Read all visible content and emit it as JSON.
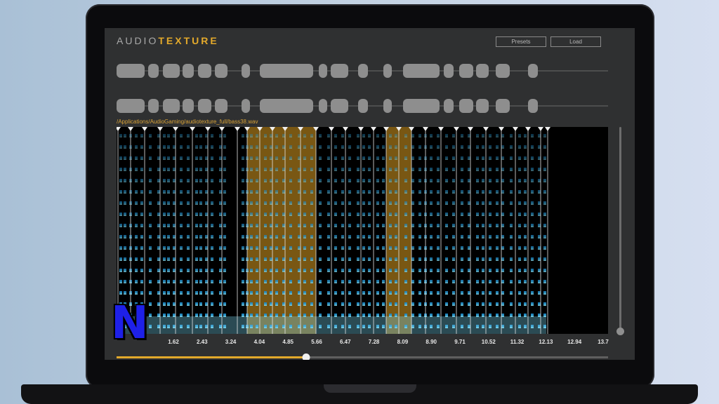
{
  "app": {
    "brand_light": "AUDIO",
    "brand_bold": "TEXTURE",
    "brand_light_color": "#a9a9a9",
    "brand_bold_color": "#e3a92b"
  },
  "toolbar": {
    "presets_label": "Presets",
    "load_label": "Load"
  },
  "file": {
    "path": "/Applications/AudioGaming/audiotexture_full/bass38.wav"
  },
  "timeline": {
    "ticks": [
      "1.62",
      "2.43",
      "3.24",
      "4.04",
      "4.85",
      "5.66",
      "6.47",
      "7.28",
      "8.09",
      "8.90",
      "9.71",
      "10.52",
      "11.32",
      "12.13",
      "12.94",
      "13.7"
    ],
    "playback_fraction": 0.385
  },
  "overlay": {
    "logo_letter": "N",
    "logo_color": "#1e20e8"
  },
  "colors": {
    "spectrogram_bright": "#7ad6f0",
    "spectrogram_base": "#1a86c8",
    "selection_tint": "#a2741a",
    "accent": "#e3a92b"
  },
  "icons": {
    "vertical_scroll_thumb": "circle-handle-icon",
    "progress_thumb": "circle-handle-icon"
  }
}
